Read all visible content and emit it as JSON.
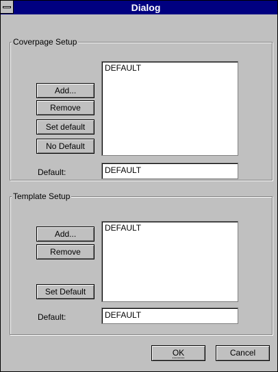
{
  "window": {
    "title": "Dialog",
    "sysmenu_icon": "system-menu-icon"
  },
  "coverpage": {
    "label": "Coverpage Setup",
    "add_label": "Add...",
    "remove_label": "Remove",
    "set_default_label": "Set default",
    "no_default_label": "No Default",
    "list_items": [
      "DEFAULT"
    ],
    "default_label": "Default:",
    "default_value": "DEFAULT"
  },
  "template": {
    "label": "Template Setup",
    "add_label": "Add...",
    "remove_label": "Remove",
    "set_default_label": "Set Default",
    "list_items": [
      "DEFAULT"
    ],
    "default_label": "Default:",
    "default_value": "DEFAULT"
  },
  "footer": {
    "ok_label": "OK",
    "cancel_label": "Cancel"
  }
}
